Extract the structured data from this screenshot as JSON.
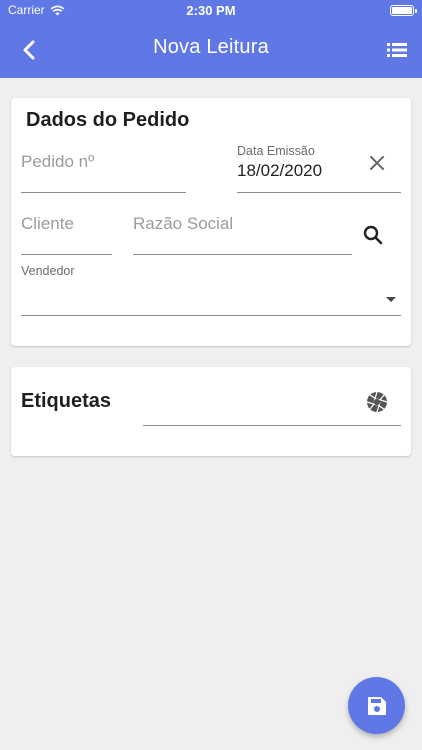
{
  "status_bar": {
    "carrier": "Carrier",
    "time": "2:30 PM"
  },
  "nav": {
    "title": "Nova Leitura"
  },
  "order_card": {
    "title": "Dados do Pedido",
    "pedido_placeholder": "Pedido nº",
    "data_emissao_label": "Data Emissão",
    "data_emissao_value": "18/02/2020",
    "cliente_placeholder": "Cliente",
    "razao_social_placeholder": "Razão Social",
    "vendedor_label": "Vendedor"
  },
  "labels_card": {
    "title": "Etiquetas"
  },
  "icons": {
    "back": "chevron-left-icon",
    "menu": "list-icon",
    "clear": "close-icon",
    "search": "search-icon",
    "dropdown": "arrow-drop-down-icon",
    "camera": "camera-shutter-icon",
    "save": "save-icon"
  },
  "colors": {
    "primary": "#5f78e6",
    "background": "#efefef"
  }
}
